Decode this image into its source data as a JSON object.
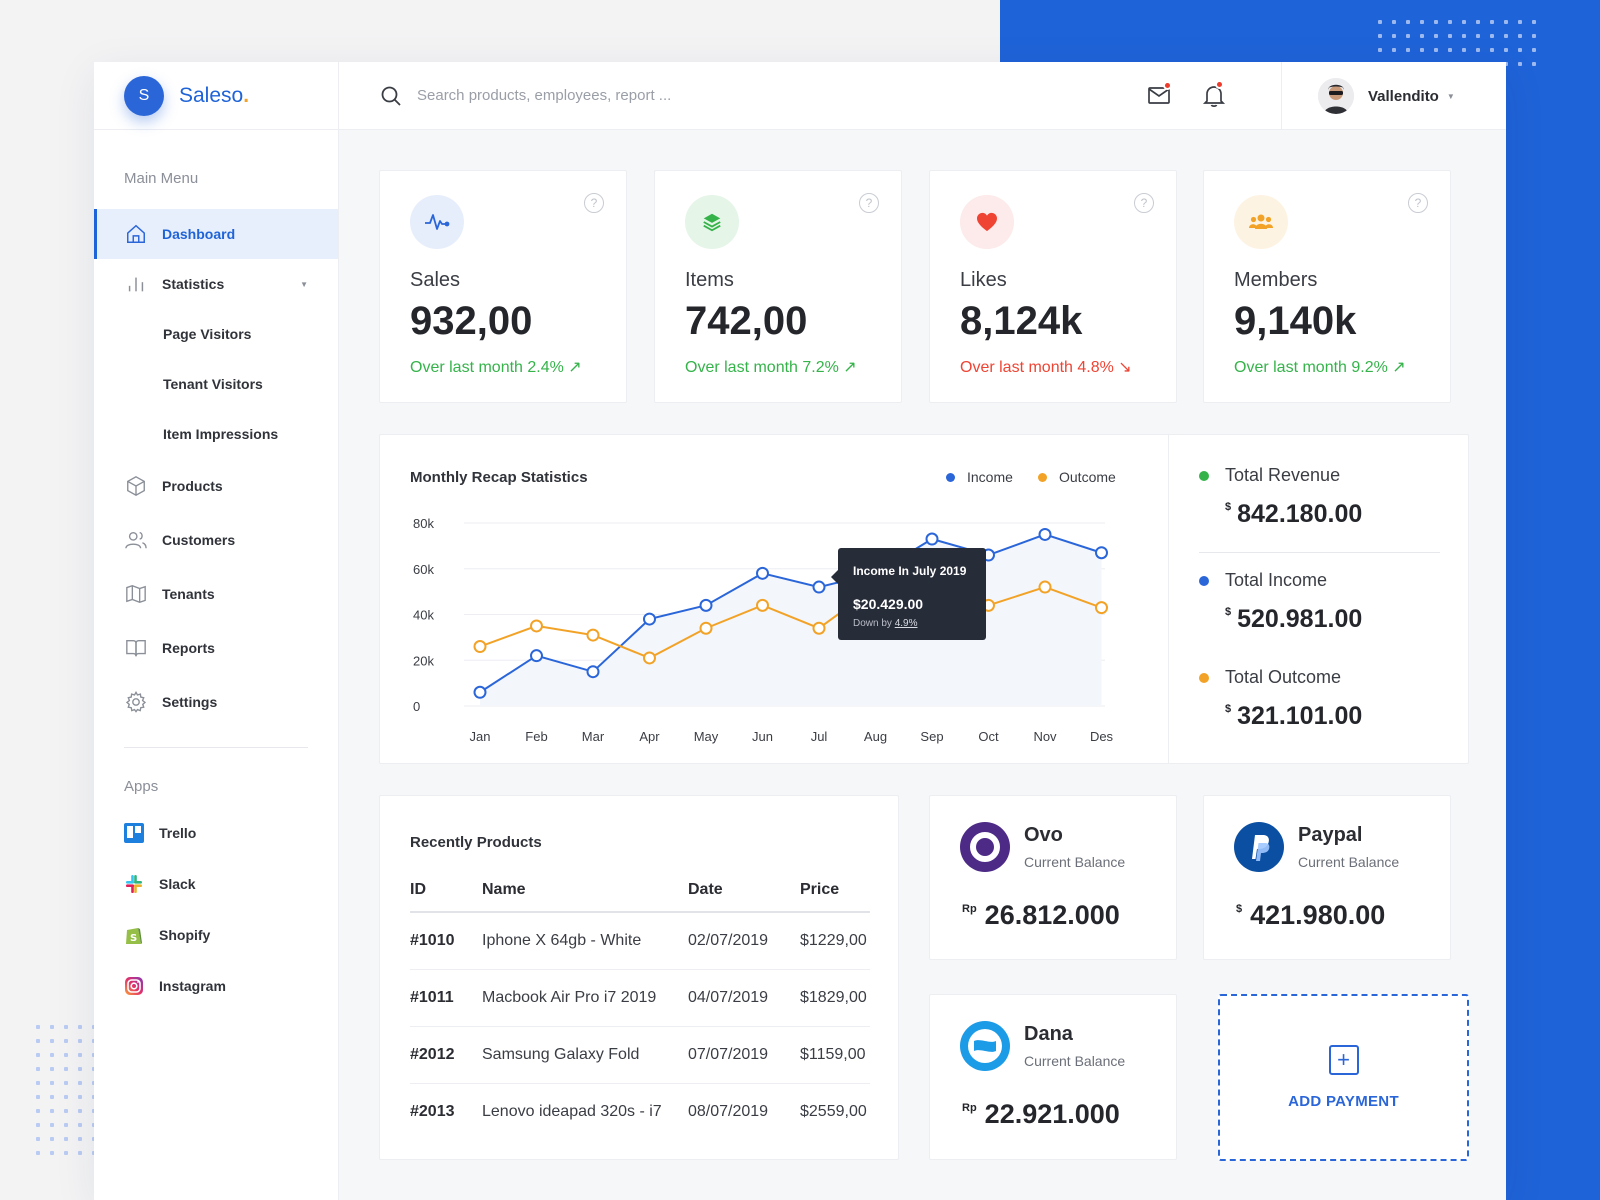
{
  "brand": {
    "logo_letter": "S",
    "name": "Saleso",
    "dot": "."
  },
  "search": {
    "placeholder": "Search products, employees, report ..."
  },
  "user": {
    "name": "Vallendito"
  },
  "sidebar": {
    "main_menu_title": "Main Menu",
    "items": [
      {
        "label": "Dashboard",
        "icon": "home-icon"
      },
      {
        "label": "Statistics",
        "icon": "bar-chart-icon"
      },
      {
        "label": "Page Visitors"
      },
      {
        "label": "Tenant Visitors"
      },
      {
        "label": "Item Impressions"
      },
      {
        "label": "Products",
        "icon": "box-icon"
      },
      {
        "label": "Customers",
        "icon": "users-icon"
      },
      {
        "label": "Tenants",
        "icon": "map-icon"
      },
      {
        "label": "Reports",
        "icon": "book-icon"
      },
      {
        "label": "Settings",
        "icon": "gear-icon"
      }
    ],
    "apps_title": "Apps",
    "apps": [
      {
        "label": "Trello",
        "icon": "trello-icon"
      },
      {
        "label": "Slack",
        "icon": "slack-icon"
      },
      {
        "label": "Shopify",
        "icon": "shopify-icon"
      },
      {
        "label": "Instagram",
        "icon": "instagram-icon"
      }
    ]
  },
  "stats": [
    {
      "label": "Sales",
      "value": "932,00",
      "change": "Over last month  2.4%",
      "trend": "up",
      "arrow": "↗",
      "icon": "pulse-icon",
      "color": "#2b66d9"
    },
    {
      "label": "Items",
      "value": "742,00",
      "change": "Over last month  7.2%",
      "trend": "up",
      "arrow": "↗",
      "icon": "layers-icon",
      "color": "#35b34a"
    },
    {
      "label": "Likes",
      "value": "8,124k",
      "change": "Over last month  4.8%",
      "trend": "down",
      "arrow": "↘",
      "icon": "heart-icon",
      "color": "#ef4433"
    },
    {
      "label": "Members",
      "value": "9,140k",
      "change": "Over last month  9.2%",
      "trend": "up",
      "arrow": "↗",
      "icon": "group-icon",
      "color": "#f2a327"
    }
  ],
  "chart": {
    "title": "Monthly Recap Statistics",
    "legend": [
      {
        "label": "Income",
        "color": "#2b66d9"
      },
      {
        "label": "Outcome",
        "color": "#f2a327"
      }
    ],
    "tooltip": {
      "title": "Income In July 2019",
      "value": "$20.429.00",
      "sub_prefix": "Down by ",
      "sub_value": "4.9%"
    }
  },
  "chart_data": {
    "type": "line",
    "categories": [
      "Jan",
      "Feb",
      "Mar",
      "Apr",
      "May",
      "Jun",
      "Jul",
      "Aug",
      "Sep",
      "Oct",
      "Nov",
      "Des"
    ],
    "y_ticks": [
      "0",
      "20k",
      "40k",
      "60k",
      "80k"
    ],
    "ylim": [
      0,
      80000
    ],
    "series": [
      {
        "name": "Income",
        "color": "#2b66d9",
        "values": [
          6000,
          22000,
          15000,
          38000,
          44000,
          58000,
          52000,
          58000,
          73000,
          66000,
          75000,
          67000
        ]
      },
      {
        "name": "Outcome",
        "color": "#f2a327",
        "values": [
          26000,
          35000,
          31000,
          21000,
          34000,
          44000,
          34000,
          52000,
          50000,
          44000,
          52000,
          43000
        ]
      }
    ]
  },
  "totals": [
    {
      "label": "Total Revenue",
      "currency": "$",
      "value": "842.180.00",
      "color": "#35b34a"
    },
    {
      "label": "Total Income",
      "currency": "$",
      "value": "520.981.00",
      "color": "#2b66d9"
    },
    {
      "label": "Total Outcome",
      "currency": "$",
      "value": "321.101.00",
      "color": "#f2a327"
    }
  ],
  "products": {
    "title": "Recently Products",
    "columns": [
      "ID",
      "Name",
      "Date",
      "Price"
    ],
    "rows": [
      [
        "#1010",
        "Iphone X 64gb - White",
        "02/07/2019",
        "$1229,00"
      ],
      [
        "#1011",
        "Macbook Air Pro i7 2019",
        "04/07/2019",
        "$1829,00"
      ],
      [
        "#2012",
        "Samsung Galaxy Fold",
        "07/07/2019",
        "$1159,00"
      ],
      [
        "#2013",
        "Lenovo ideapad 320s - i7",
        "08/07/2019",
        "$2559,00"
      ]
    ]
  },
  "payments": [
    {
      "name": "Ovo",
      "sub": "Current Balance",
      "currency": "Rp",
      "value": "26.812.000",
      "icon": "ovo-icon"
    },
    {
      "name": "Paypal",
      "sub": "Current Balance",
      "currency": "$",
      "value": "421.980.00",
      "icon": "paypal-icon"
    },
    {
      "name": "Dana",
      "sub": "Current Balance",
      "currency": "Rp",
      "value": "22.921.000",
      "icon": "dana-icon"
    }
  ],
  "add_payment": {
    "label": "ADD PAYMENT"
  }
}
